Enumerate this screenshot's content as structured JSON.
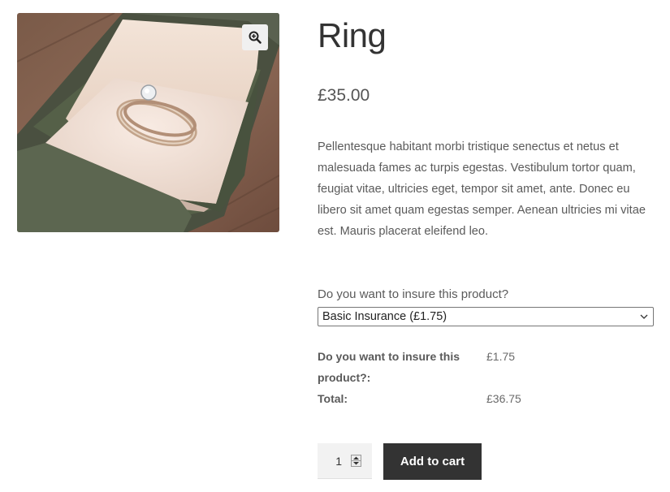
{
  "product": {
    "title": "Ring",
    "price": "£35.00",
    "description": "Pellentesque habitant morbi tristique senectus et netus et malesuada fames ac turpis egestas. Vestibulum tortor quam, feugiat vitae, ultricies eget, tempor sit amet, ante. Donec eu libero sit amet quam egestas semper. Aenean ultricies mi vitae est. Mauris placerat eleifend leo.",
    "image_icon": "zoom-in-icon"
  },
  "insurance": {
    "label": "Do you want to insure this product?",
    "selected_option": "Basic Insurance (£1.75)"
  },
  "totals": {
    "rows": [
      {
        "label": "Do you want to insure this product?:",
        "value": "£1.75"
      },
      {
        "label": "Total:",
        "value": "£36.75"
      }
    ]
  },
  "cart": {
    "quantity": "1",
    "add_label": "Add to cart"
  },
  "colors": {
    "button_bg": "#333333",
    "text": "#43454b"
  }
}
